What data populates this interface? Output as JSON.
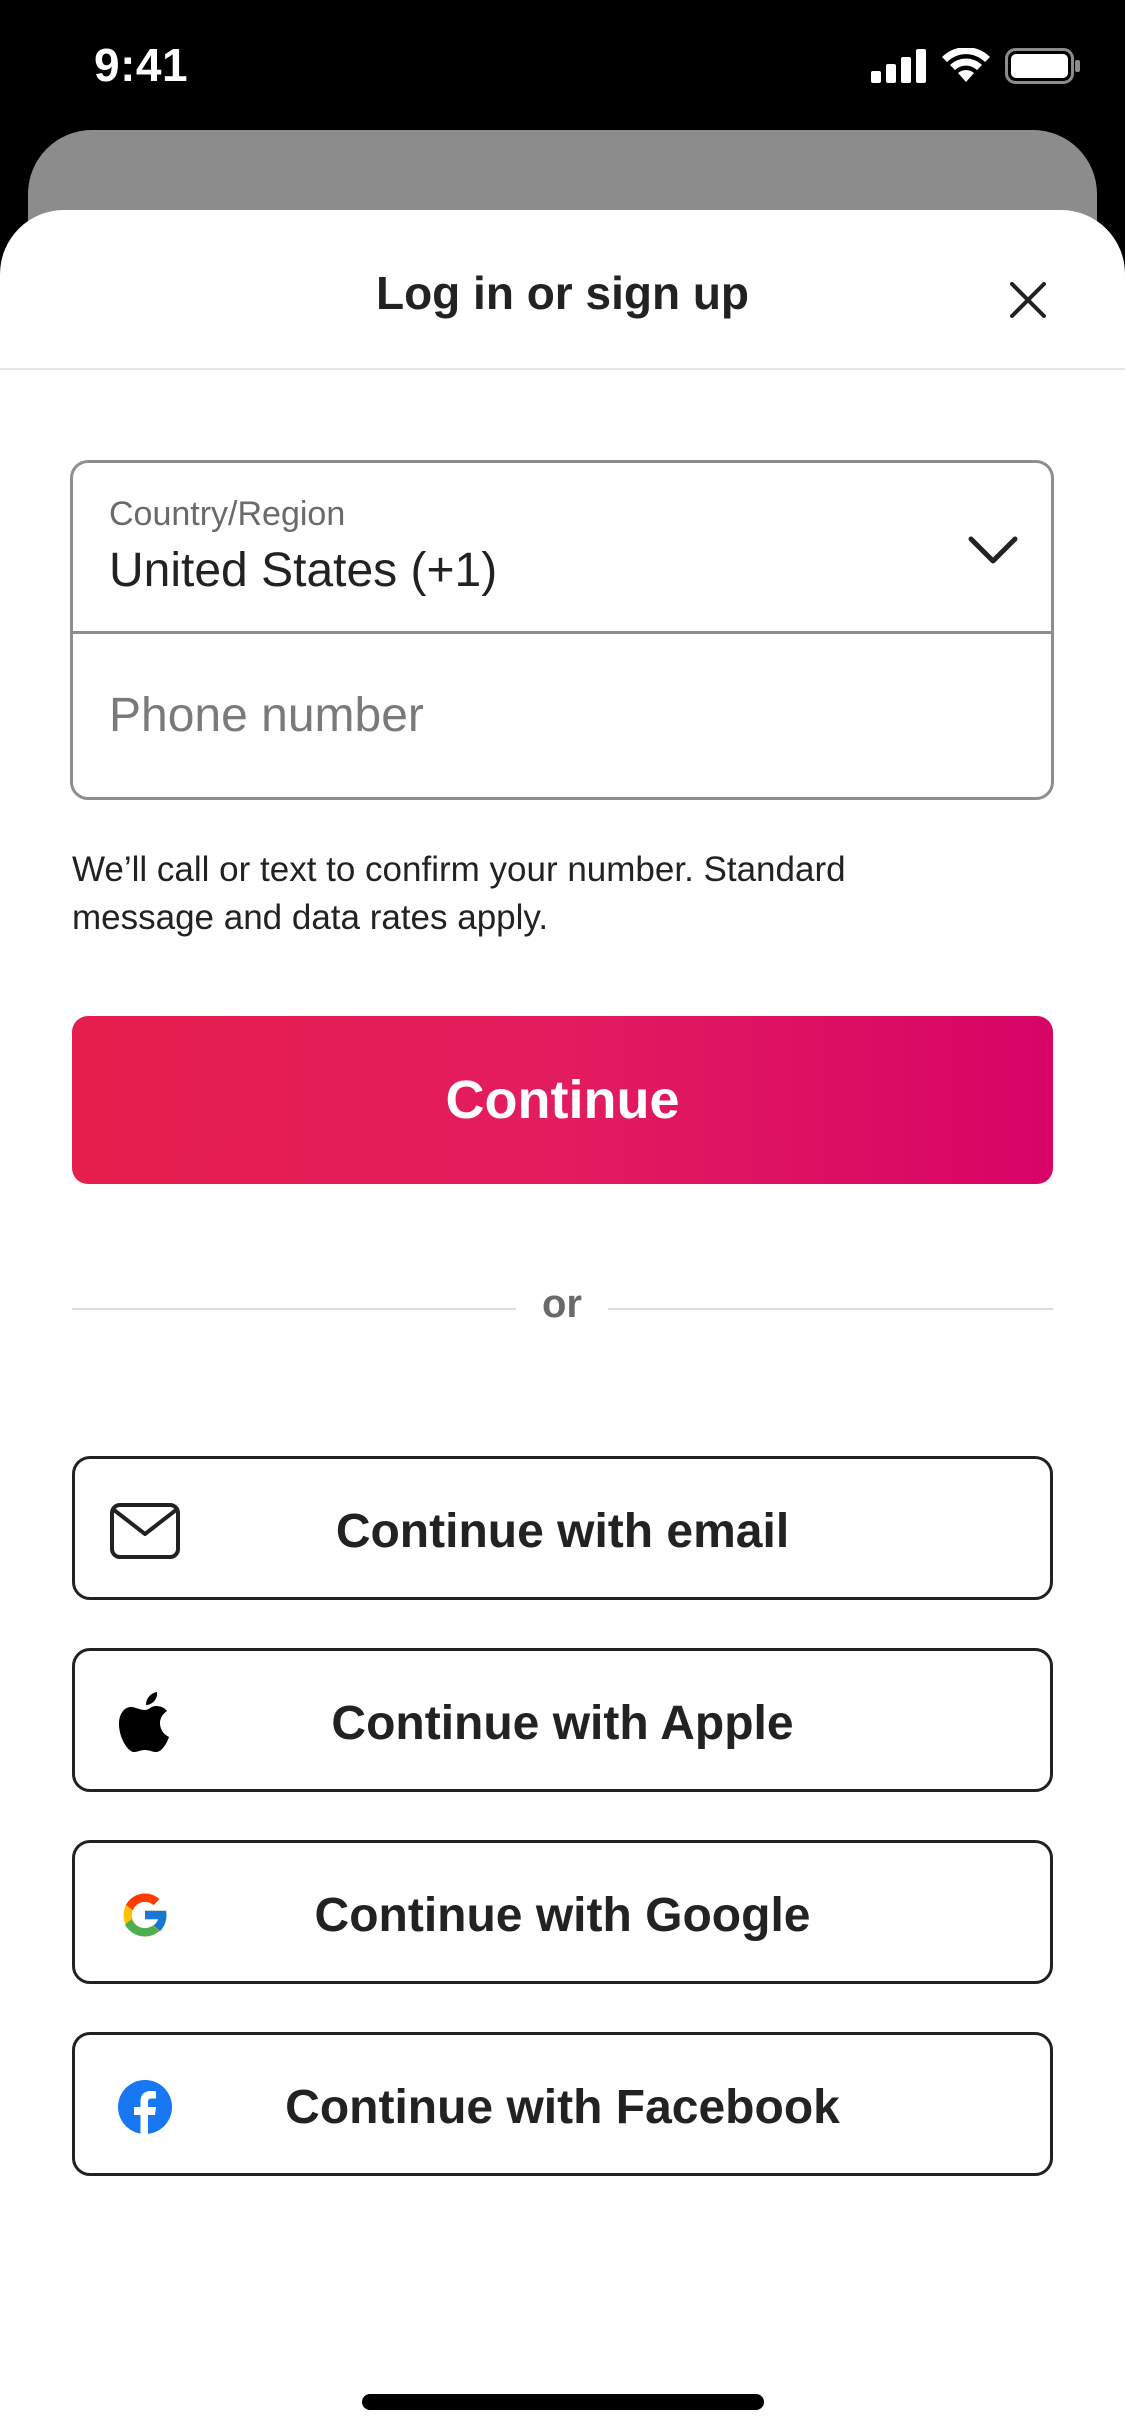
{
  "status_bar": {
    "time": "9:41",
    "icons": [
      "cellular-signal-icon",
      "wifi-icon",
      "battery-icon"
    ]
  },
  "sheet": {
    "title": "Log in or sign up",
    "close_icon": "close-icon"
  },
  "phone_form": {
    "country_label": "Country/Region",
    "country_value": "United States (+1)",
    "phone_placeholder": "Phone number",
    "phone_value": "",
    "helper_text": "We’ll call or text to confirm your number. Standard message and data rates apply."
  },
  "continue_button": {
    "label": "Continue"
  },
  "divider": {
    "text": "or"
  },
  "social_buttons": [
    {
      "label": "Continue with email",
      "icon": "envelope-icon"
    },
    {
      "label": "Continue with Apple",
      "icon": "apple-icon"
    },
    {
      "label": "Continue with Google",
      "icon": "google-icon"
    },
    {
      "label": "Continue with Facebook",
      "icon": "facebook-icon"
    }
  ],
  "colors": {
    "accent_start": "#e61e4d",
    "accent_end": "#d70466",
    "text_primary": "#222222",
    "text_secondary": "#6a6a6a",
    "facebook_blue": "#1877f2"
  }
}
